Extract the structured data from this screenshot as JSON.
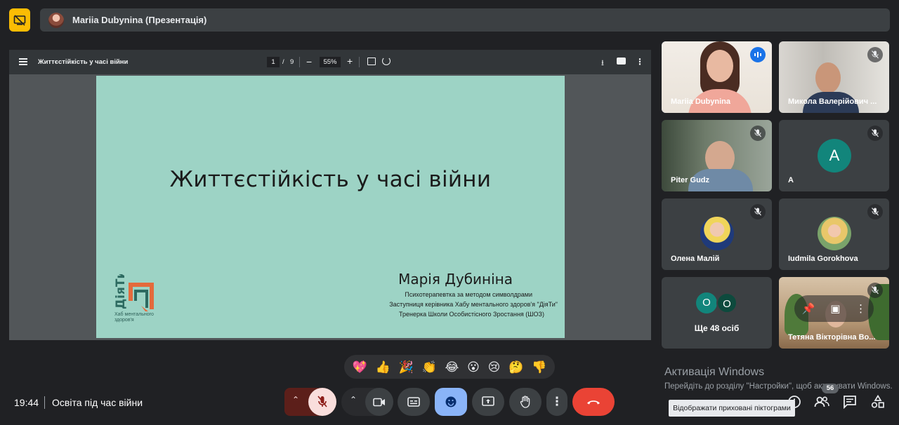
{
  "top_bar": {
    "presenter_title": "Mariia Dubynina (Презентація)"
  },
  "pdf_viewer": {
    "doc_title": "Життєстійкість у часі війни",
    "current_page": "1",
    "page_separator": "/",
    "total_pages": "9",
    "zoom": "55%"
  },
  "slide": {
    "title": "Життєстійкість у часі війни",
    "author": "Марія Дубиніна",
    "subtitle_1": "Психотерапевтка за методом символдрами",
    "subtitle_2": "Заступниця керівника Хабу ментального здоров'я \"ДіяТи\"",
    "subtitle_3": "Тренерка Школи Особистісного Зростання (ШОЗ)",
    "logo_word": "ДіяТи",
    "logo_caption": "Хаб ментального здоров'я"
  },
  "participants": [
    {
      "name": "Mariia Dubynina"
    },
    {
      "name": "Микола Валерійович ..."
    },
    {
      "name": "Piter Gudz"
    },
    {
      "name": "A",
      "initial": "A"
    },
    {
      "name": "Олена Малій"
    },
    {
      "name": "Iudmila Gorokhova"
    },
    {
      "name": "Тетяна Вікторівна Во..."
    }
  ],
  "more_tile": {
    "circle_1": "О",
    "circle_2": "О",
    "label": "Ще 48 осіб"
  },
  "reactions": [
    "💖",
    "👍",
    "🎉",
    "👏",
    "😂",
    "😮",
    "😢",
    "🤔",
    "👎"
  ],
  "windows": {
    "activate_title": "Активація Windows",
    "activate_sub": "Перейдіть до розділу \"Настройки\", щоб активувати Windows."
  },
  "bottom": {
    "time": "19:44",
    "meeting_name": "Освіта під час війни",
    "people_count": "56",
    "tooltip": "Відображати приховані піктограми"
  },
  "colors": {
    "background": "#202124",
    "present_badge": "#fbbc04",
    "active_outline": "#8ab4f8",
    "slide_bg": "#9dd3c5",
    "end_call": "#ea4335",
    "reaction_button": "#8ab4f8",
    "mic_off": "#f9dedc",
    "avatar_teal": "#12857b"
  }
}
